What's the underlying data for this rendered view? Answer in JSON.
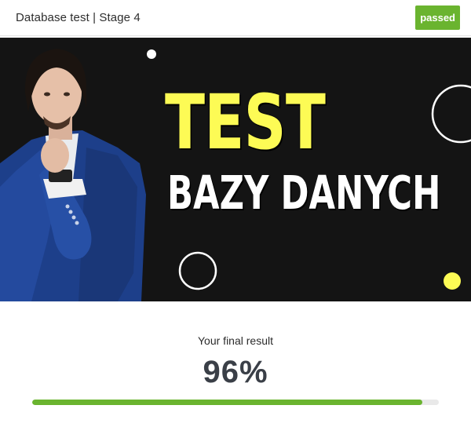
{
  "header": {
    "title": "Database test | Stage 4",
    "status_badge": "passed",
    "status_color": "#6ab42f"
  },
  "banner": {
    "headline_line1": "TEST",
    "headline_line2": "BAZY DANYCH",
    "headline_color": "#fdfb55",
    "background_color": "#141414",
    "image_subject": "man-in-blue-suit-photo"
  },
  "result": {
    "label": "Your final result",
    "value": "96%",
    "progress": 0.96,
    "progress_color": "#6ab42f"
  }
}
